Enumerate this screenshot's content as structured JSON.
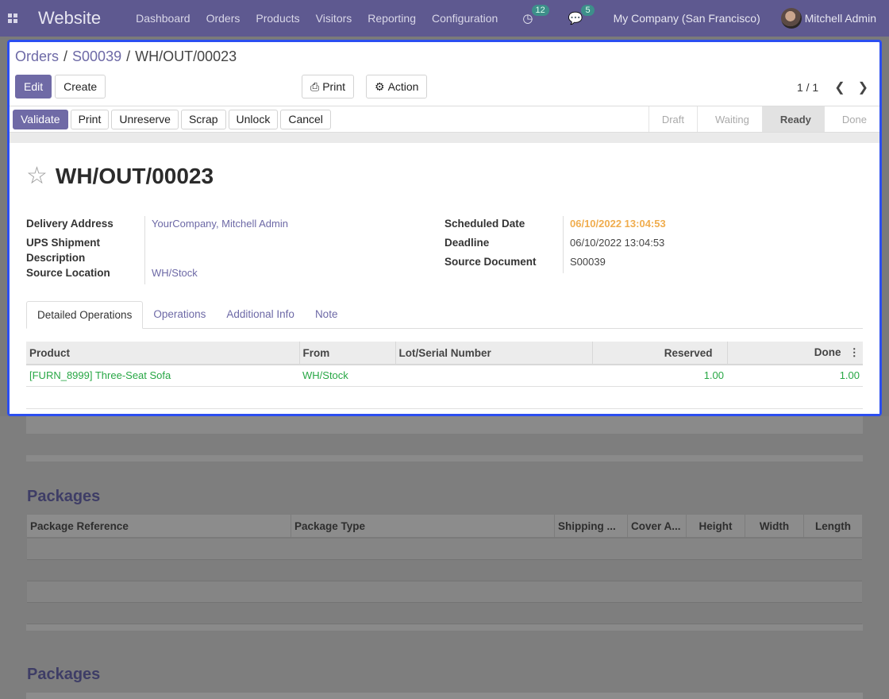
{
  "navbar": {
    "brand": "Website",
    "menu": [
      "Dashboard",
      "Orders",
      "Products",
      "Visitors",
      "Reporting",
      "Configuration"
    ],
    "activities_count": "12",
    "messages_count": "5",
    "company": "My Company (San Francisco)",
    "user": "Mitchell Admin"
  },
  "breadcrumb": {
    "orders": "Orders",
    "sep": "/",
    "order": "S00039",
    "current": "WH/OUT/00023"
  },
  "cp": {
    "edit": "Edit",
    "create": "Create",
    "print": "Print",
    "action": "Action",
    "pager": "1 / 1"
  },
  "statusbar": {
    "actions": [
      "Validate",
      "Print",
      "Unreserve",
      "Scrap",
      "Unlock",
      "Cancel"
    ],
    "steps": [
      "Draft",
      "Waiting",
      "Ready",
      "Done"
    ],
    "active_step": "Ready"
  },
  "record": {
    "title": "WH/OUT/00023",
    "left": [
      {
        "label": "Delivery Address",
        "value": "YourCompany, Mitchell Admin"
      },
      {
        "label": "UPS Shipment Description",
        "value": ""
      },
      {
        "label": "Source Location",
        "value": "WH/Stock"
      }
    ],
    "right": [
      {
        "label": "Scheduled Date",
        "value": "06/10/2022 13:04:53"
      },
      {
        "label": "Deadline",
        "value": "06/10/2022 13:04:53"
      },
      {
        "label": "Source Document",
        "value": "S00039"
      }
    ]
  },
  "tabs": [
    "Detailed Operations",
    "Operations",
    "Additional Info",
    "Note"
  ],
  "ops_table": {
    "headers": [
      "Product",
      "From",
      "Lot/Serial Number",
      "Reserved",
      "Done"
    ],
    "rows": [
      {
        "product": "[FURN_8999] Three-Seat Sofa",
        "from": "WH/Stock",
        "lot": "",
        "reserved": "1.00",
        "done": "1.00"
      }
    ]
  },
  "packages": {
    "heading": "Packages",
    "headers": [
      "Package Reference",
      "Package Type",
      "Shipping ...",
      "Cover A...",
      "Height",
      "Width",
      "Length"
    ]
  },
  "colors": {
    "navbar": "#5e5990",
    "primary": "#6f6aa6",
    "focus_border": "#2b4ef0",
    "link_green": "#28a745",
    "warning": "#f0ad4e"
  }
}
